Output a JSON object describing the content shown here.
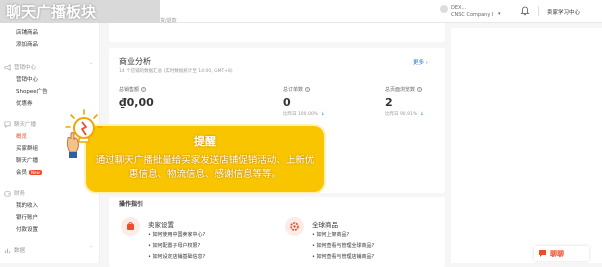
{
  "banner": {
    "title": "聊天广播板块"
  },
  "header": {
    "task_note": "待处理退货/退款",
    "shop_name": "DEX...",
    "company": "CNSC Company I",
    "learn_center": "卖家学习中心"
  },
  "sidebar": {
    "items_top": [
      {
        "label": "店铺商品"
      },
      {
        "label": "添加商品"
      }
    ],
    "marketing": {
      "group": "营销中心",
      "items": [
        {
          "label": "营销中心"
        },
        {
          "label": "Shopee广告"
        },
        {
          "label": "优惠券"
        }
      ]
    },
    "chat": {
      "group": "聊天广播",
      "items": [
        {
          "label": "概览",
          "active": true
        },
        {
          "label": "买家群组"
        },
        {
          "label": "聊天广播"
        },
        {
          "label": "会员",
          "badge": "New"
        }
      ]
    },
    "finance": {
      "group": "财务",
      "items": [
        {
          "label": "我的收入"
        },
        {
          "label": "银行账户"
        },
        {
          "label": "付款设置"
        }
      ]
    },
    "data": {
      "group": "数据"
    }
  },
  "analysis": {
    "title": "商业分析",
    "subtitle": "14 个店铺的数据汇总 (实时数据统计至 14:00, GMT+8)",
    "more": "更多",
    "metrics": [
      {
        "label": "总销售额",
        "value": "₫0,00",
        "compare": ""
      },
      {
        "label": "总订单数",
        "value": "0",
        "compare": "比昨日",
        "change": "100.00%"
      },
      {
        "label": "总页面浏览数",
        "value": "2",
        "compare": "比昨日",
        "change": "90.91%"
      }
    ]
  },
  "guide": {
    "title": "操作指引",
    "sections": [
      {
        "name": "卖家设置",
        "links": [
          "• 如何使用中国卖家中心?",
          "• 如何配置子母户权限?",
          "• 如何设定店铺基础信息?"
        ]
      },
      {
        "name": "全球商品",
        "links": [
          "• 如何上架商品?",
          "• 如何查看与管理全球商品?",
          "• 如何查看与管理店铺商品?"
        ]
      }
    ]
  },
  "tooltip": {
    "title": "提醒",
    "body": "通过聊天广播批量给买家发送店铺促销活动、上新优惠信息、物流信息、感谢信息等等。"
  },
  "chat_widget": {
    "label": "聊聊"
  },
  "colors": {
    "accent": "#ee4d2d",
    "tooltip_bg": "#f9c500",
    "positive": "#26aa99"
  }
}
